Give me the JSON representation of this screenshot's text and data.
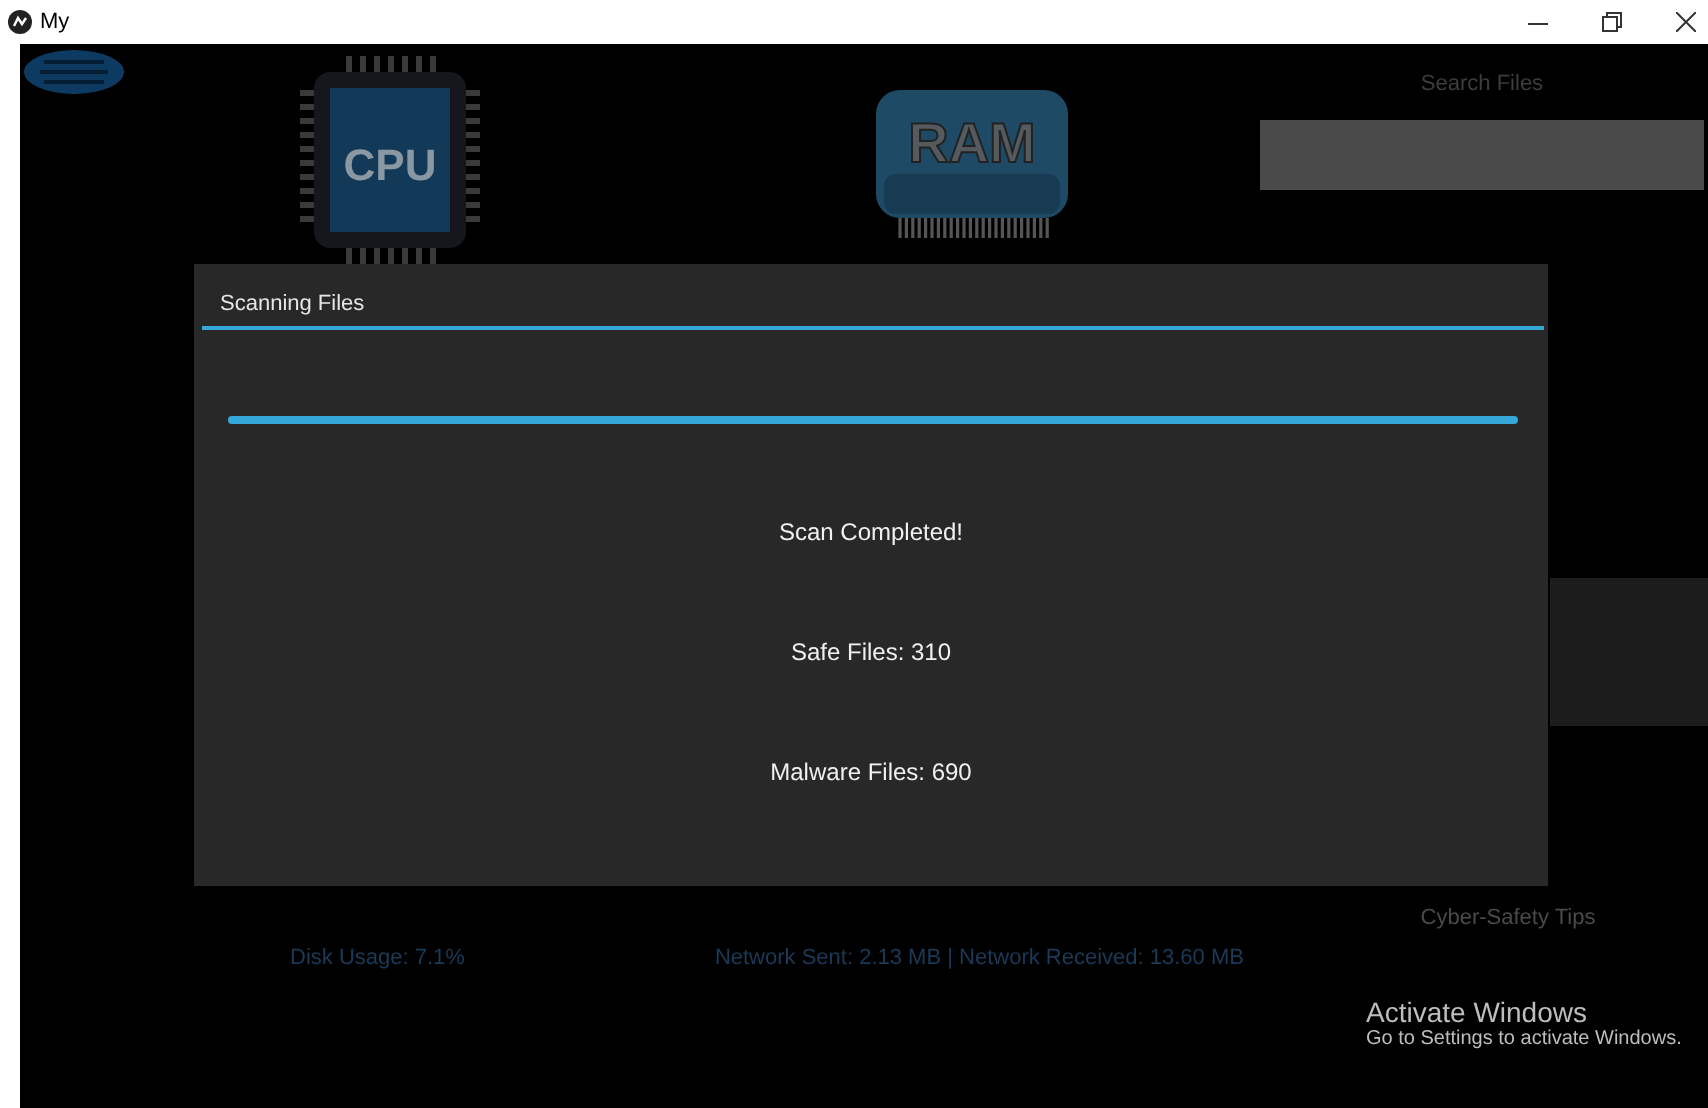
{
  "window": {
    "title": "My"
  },
  "monitors": [
    {
      "kind": "cpu",
      "label": "CPU"
    },
    {
      "kind": "ram",
      "label": "RAM"
    }
  ],
  "search": {
    "label": "Search Files"
  },
  "dialog": {
    "title": "Scanning Files",
    "progress": {
      "level": 1
    },
    "messages": [
      "Scan Completed!",
      "Safe Files: 310",
      "Malware Files: 690"
    ]
  },
  "tips": {
    "label": "Cyber-Safety Tips"
  },
  "stats": {
    "disk": "Disk Usage: 7.1%",
    "network": "Network Sent: 2.13 MB | Network Received: 13.60 MB"
  },
  "os_notice": {
    "title": "Activate Windows",
    "text": "Go to Settings to activate Windows."
  }
}
